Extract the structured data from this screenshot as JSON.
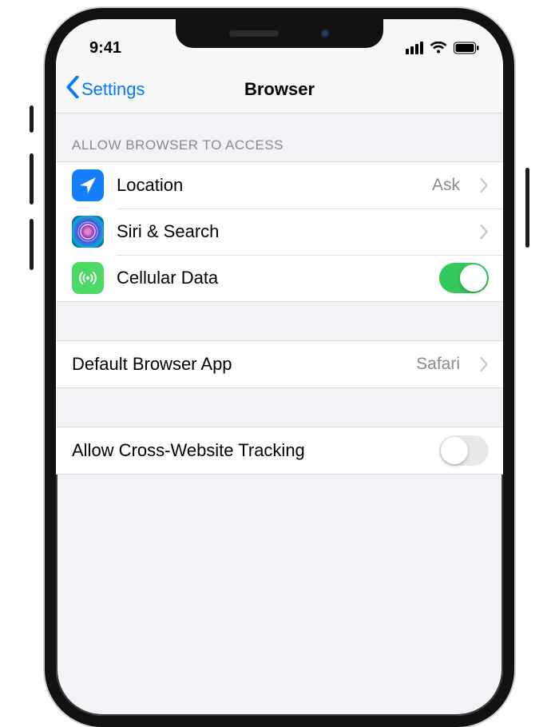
{
  "statusbar": {
    "time": "9:41"
  },
  "nav": {
    "back_label": "Settings",
    "title": "Browser"
  },
  "section1": {
    "header": "ALLOW BROWSER TO ACCESS",
    "location": {
      "label": "Location",
      "value": "Ask"
    },
    "siri": {
      "label": "Siri & Search"
    },
    "cellular": {
      "label": "Cellular Data",
      "on": true
    }
  },
  "section2": {
    "default_browser": {
      "label": "Default Browser App",
      "value": "Safari"
    }
  },
  "section3": {
    "cross_tracking": {
      "label": "Allow Cross-Website Tracking",
      "on": false
    }
  }
}
